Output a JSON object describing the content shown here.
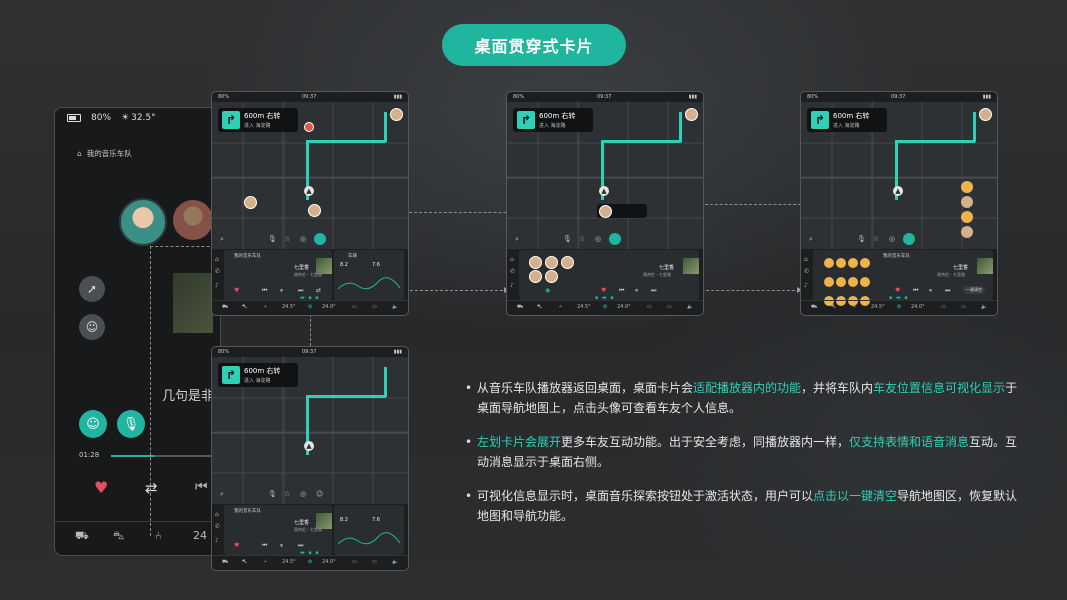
{
  "title": "桌面贯穿式卡片",
  "big_phone": {
    "battery": "80%",
    "temp": "32.5°",
    "team_name": "我的音乐车队",
    "lyric": "几句是非",
    "time": "01:28",
    "bar_value": "24"
  },
  "phone": {
    "battery": "80%",
    "temp": "32.5",
    "clock": "09:37",
    "distance": "600m 右转",
    "road": "进入 海淀路",
    "team_title": "我的音乐车队",
    "song": "七里香",
    "artist": "周杰伦 - 七里香",
    "stat1": "8.2",
    "stat2": "7.6",
    "temp_left": "24.5°",
    "temp_right": "24.0°",
    "drive_label": "车辆",
    "clear_label": "一键清空"
  },
  "bullets": [
    {
      "parts": [
        {
          "t": "从音乐车队播放器返回桌面，桌面卡片会",
          "h": false
        },
        {
          "t": "适配播放器内的功能",
          "h": true
        },
        {
          "t": "，并将车队内",
          "h": false
        },
        {
          "t": "车友位置信息可视化显示",
          "h": true
        },
        {
          "t": "于桌面导航地图上，点击头像可查看车友个人信息。",
          "h": false
        }
      ]
    },
    {
      "parts": [
        {
          "t": "左划卡片会展开",
          "h": true
        },
        {
          "t": "更多车友互动功能。出于安全考虑，同播放器内一样，",
          "h": false
        },
        {
          "t": "仅支持表情和语音消息",
          "h": true
        },
        {
          "t": "互动。互动消息显示于桌面右侧。",
          "h": false
        }
      ]
    },
    {
      "parts": [
        {
          "t": "可视化信息显示时，桌面音乐探索按钮处于激活状态，用户可以",
          "h": false
        },
        {
          "t": "点击以一键清空",
          "h": true
        },
        {
          "t": "导航地图区，恢复默认地图和导航功能。",
          "h": false
        }
      ]
    }
  ],
  "colors": {
    "accent": "#1fb59e",
    "route": "#2fd0b5",
    "like": "#e84a5f"
  }
}
